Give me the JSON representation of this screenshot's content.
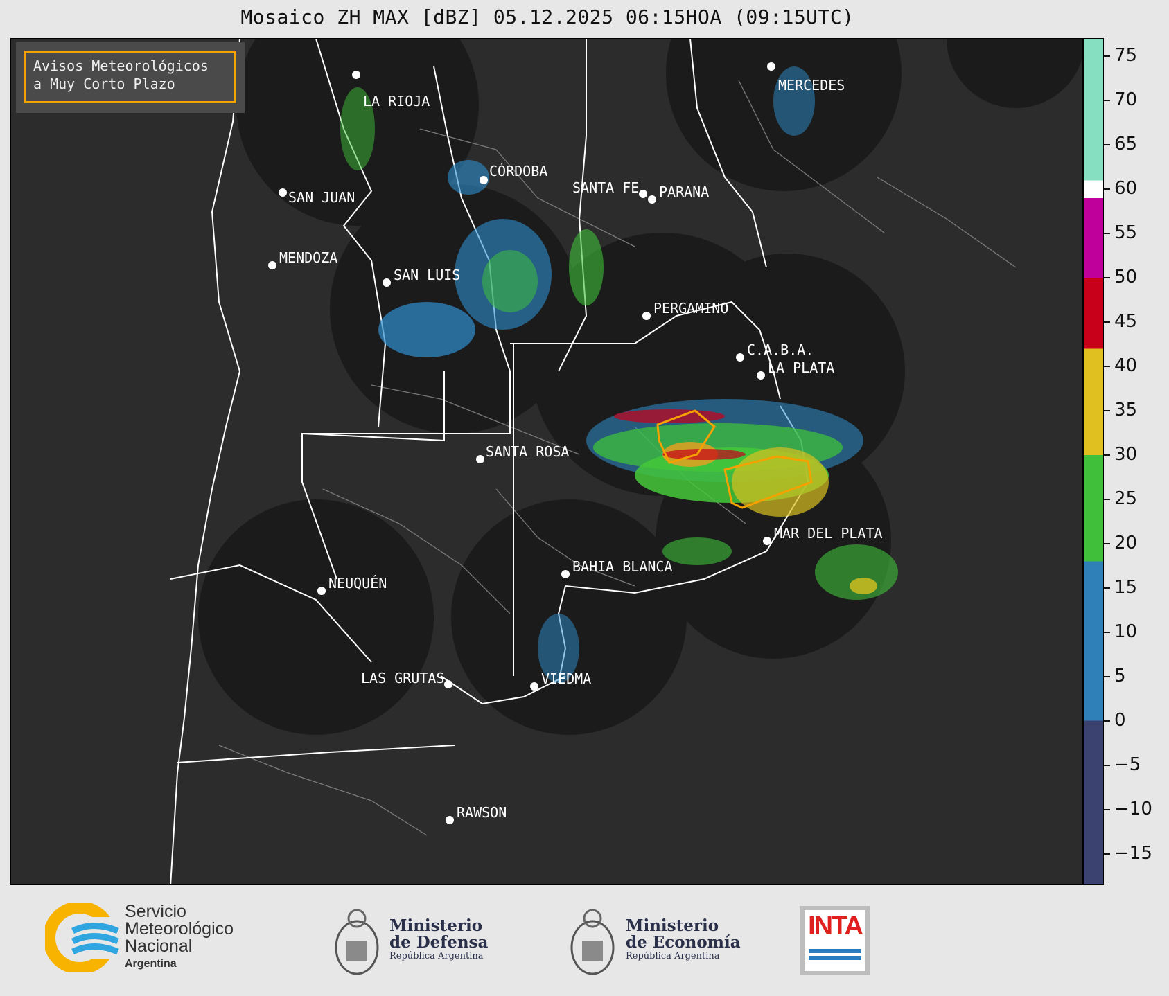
{
  "title": "Mosaico ZH MAX [dBZ] 05.12.2025 06:15HOA (09:15UTC)",
  "legend": {
    "line1": "Avisos Meteorológicos",
    "line2": "a Muy Corto Plazo",
    "border_color": "#f5a100"
  },
  "cities": [
    {
      "name": "LA RIOJA"
    },
    {
      "name": "MERCEDES"
    },
    {
      "name": "SAN JUAN"
    },
    {
      "name": "CÓRDOBA"
    },
    {
      "name": "SANTA FE"
    },
    {
      "name": "PARANA"
    },
    {
      "name": "MENDOZA"
    },
    {
      "name": "SAN LUIS"
    },
    {
      "name": "PERGAMINO"
    },
    {
      "name": "C.A.B.A."
    },
    {
      "name": "LA PLATA"
    },
    {
      "name": "SANTA ROSA"
    },
    {
      "name": "MAR DEL PLATA"
    },
    {
      "name": "BAHIA BLANCA"
    },
    {
      "name": "NEUQUÉN"
    },
    {
      "name": "LAS GRUTAS"
    },
    {
      "name": "VIEDMA"
    },
    {
      "name": "RAWSON"
    }
  ],
  "colorbar": {
    "unit": "dBZ",
    "ticks": [
      "75",
      "70",
      "65",
      "60",
      "55",
      "50",
      "45",
      "40",
      "35",
      "30",
      "25",
      "20",
      "15",
      "10",
      "5",
      "0",
      "−5",
      "−10",
      "−15"
    ],
    "stops": [
      {
        "from": -18,
        "to": 0,
        "color": "#3b4270"
      },
      {
        "from": 0,
        "to": 18,
        "color": "#2f7fb8"
      },
      {
        "from": 18,
        "to": 30,
        "color": "#3fbf3a"
      },
      {
        "from": 30,
        "to": 42,
        "color": "#e0c020"
      },
      {
        "from": 42,
        "to": 50,
        "color": "#c8001a"
      },
      {
        "from": 50,
        "to": 59,
        "color": "#c0009a"
      },
      {
        "from": 59,
        "to": 61,
        "color": "#ffffff"
      },
      {
        "from": 61,
        "to": 77,
        "color": "#86dfc0"
      }
    ]
  },
  "logos": {
    "smn": {
      "line1": "Servicio",
      "line2": "Meteorológico",
      "line3": "Nacional",
      "line4": "Argentina"
    },
    "defensa": {
      "line1": "Ministerio",
      "line2": "de Defensa",
      "line3": "República Argentina"
    },
    "economia": {
      "line1": "Ministerio",
      "line2": "de Economía",
      "line3": "República Argentina"
    },
    "inta": {
      "text": "INTA"
    }
  }
}
